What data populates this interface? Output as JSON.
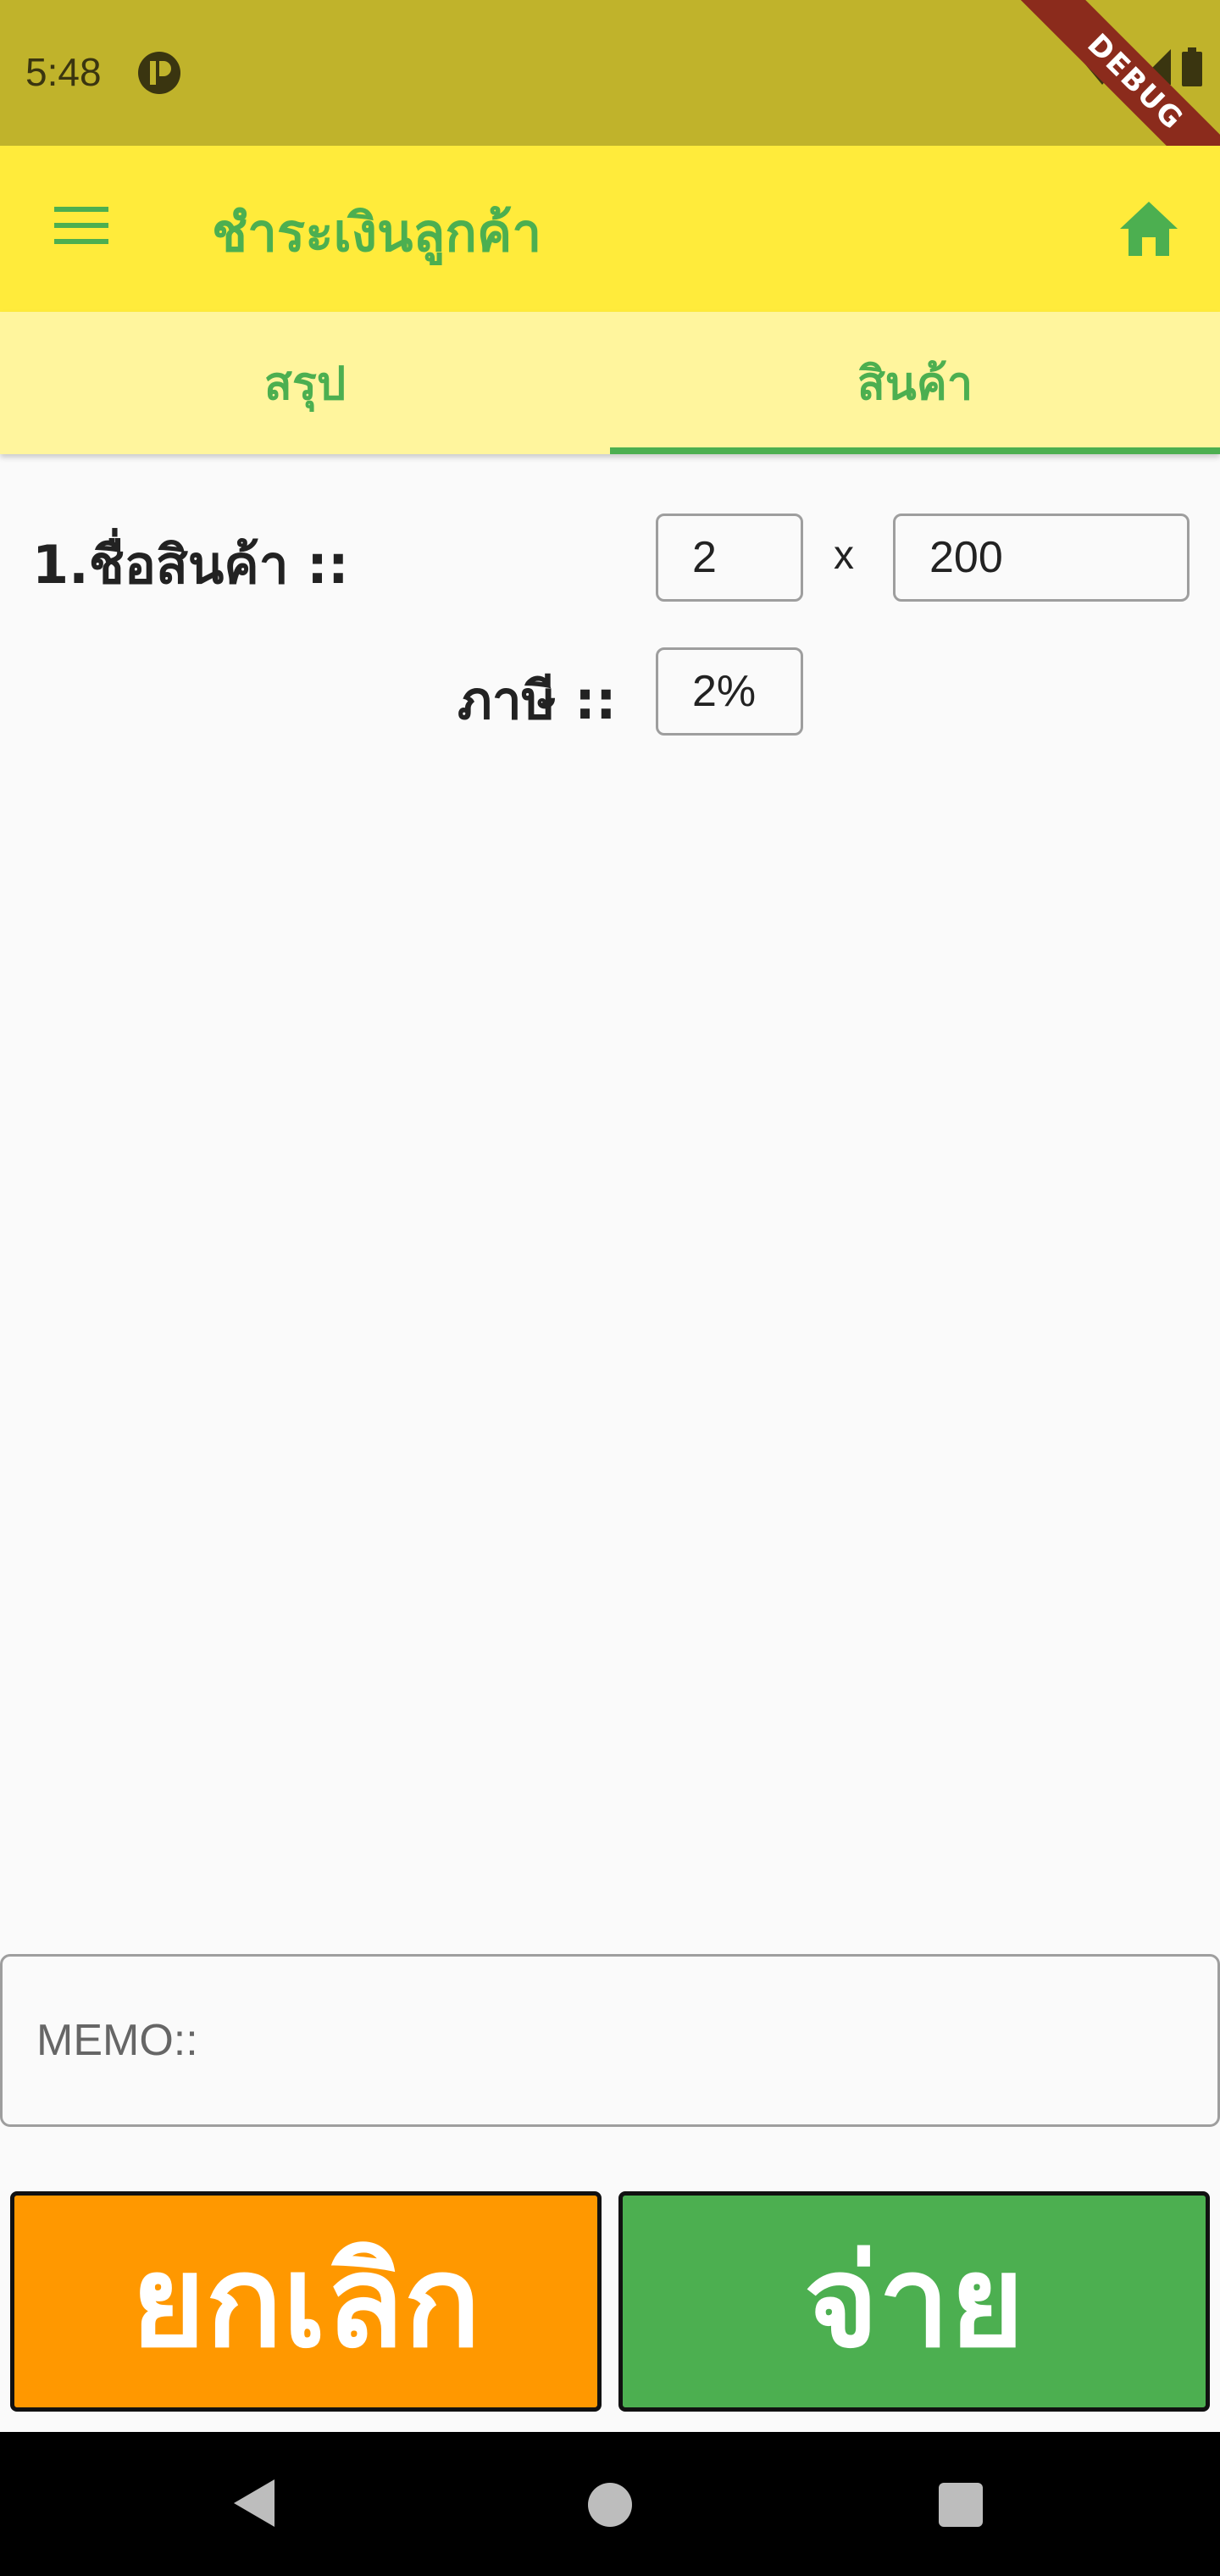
{
  "status_bar": {
    "time": "5:48",
    "debug_label": "DEBUG"
  },
  "app_bar": {
    "title": "ชำระเงินลูกค้า"
  },
  "tabs": [
    {
      "label": "สรุป",
      "active": false
    },
    {
      "label": "สินค้า",
      "active": true
    }
  ],
  "item": {
    "label": "1.ชื่อสินค้า ::",
    "quantity": "2",
    "times": "x",
    "price": "200",
    "tax_label": "ภาษี ::",
    "tax": "2%"
  },
  "memo": {
    "placeholder": "MEMO::"
  },
  "buttons": {
    "cancel": "ยกเลิก",
    "pay": "จ่าย"
  },
  "colors": {
    "status_bar": "#c0b32b",
    "app_bar": "#ffeb3b",
    "tab_bar": "#fff59d",
    "accent": "#4caf50",
    "cancel": "#ff9800"
  }
}
